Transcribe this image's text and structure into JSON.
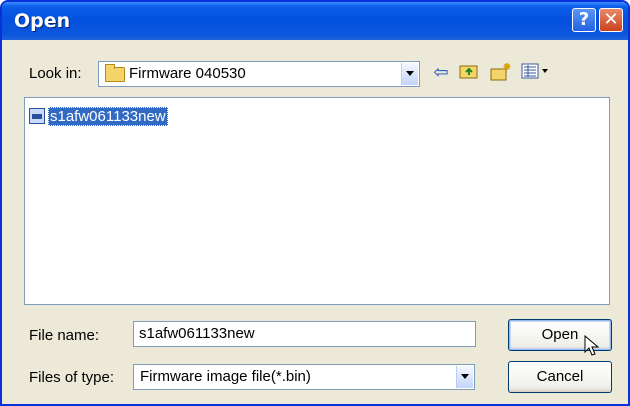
{
  "window": {
    "title": "Open",
    "help_glyph": "?",
    "close_glyph": "✕"
  },
  "toolbar": {
    "look_in_label": "Look in:",
    "look_in_value": "Firmware 040530",
    "icons": [
      "back-arrow-icon",
      "up-folder-icon",
      "new-folder-icon",
      "view-menu-icon"
    ]
  },
  "files": [
    {
      "name": "s1afw061133new",
      "selected": true,
      "icon": "bin-file-icon"
    }
  ],
  "form": {
    "file_name_label": "File name:",
    "file_name_value": "s1afw061133new",
    "file_type_label": "Files of type:",
    "file_type_value": "Firmware image file(*.bin)"
  },
  "buttons": {
    "open": "Open",
    "cancel": "Cancel"
  },
  "colors": {
    "title_bar": "#0451e0",
    "selection": "#316ac5",
    "dialog_bg": "#ece9d8"
  }
}
